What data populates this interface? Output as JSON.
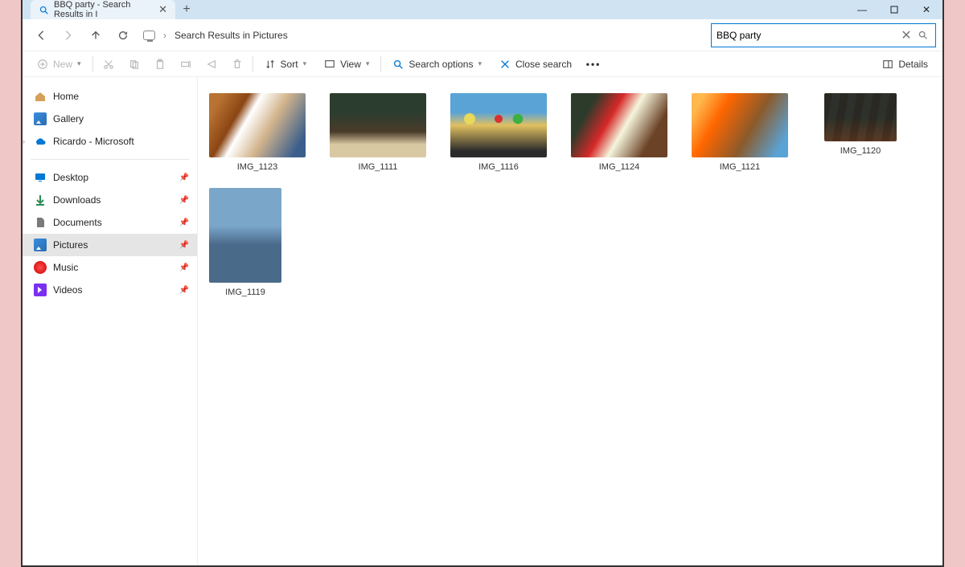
{
  "titlebar": {
    "tab_title": "BBQ party - Search Results in I",
    "window_controls": {
      "minimize": "—",
      "maximize": "▢",
      "close": "✕"
    }
  },
  "nav": {
    "breadcrumb": "Search Results in Pictures",
    "search_value": "BBQ party"
  },
  "toolbar": {
    "new_label": "New",
    "sort_label": "Sort",
    "view_label": "View",
    "search_options_label": "Search options",
    "close_search_label": "Close search",
    "details_label": "Details"
  },
  "sidebar": {
    "top": [
      {
        "label": "Home"
      },
      {
        "label": "Gallery"
      },
      {
        "label": "Ricardo - Microsoft"
      }
    ],
    "pinned": [
      {
        "label": "Desktop"
      },
      {
        "label": "Downloads"
      },
      {
        "label": "Documents"
      },
      {
        "label": "Pictures"
      },
      {
        "label": "Music"
      },
      {
        "label": "Videos"
      }
    ]
  },
  "results": [
    {
      "name": "IMG_1123"
    },
    {
      "name": "IMG_1111"
    },
    {
      "name": "IMG_1116"
    },
    {
      "name": "IMG_1124"
    },
    {
      "name": "IMG_1121"
    },
    {
      "name": "IMG_1120"
    },
    {
      "name": "IMG_1119"
    }
  ]
}
